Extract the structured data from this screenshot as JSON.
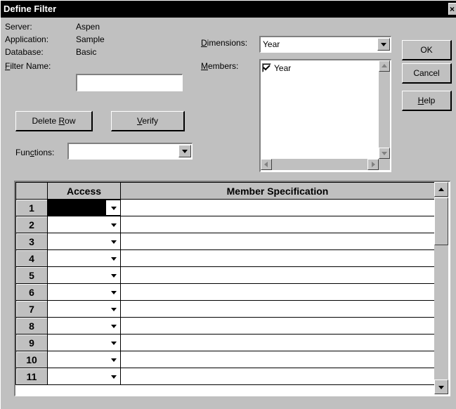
{
  "window": {
    "title": "Define Filter",
    "close_glyph": "×"
  },
  "info": {
    "server_label": "Server:",
    "server_value": "Aspen",
    "application_label": "Application:",
    "application_value": "Sample",
    "database_label": "Database:",
    "database_value": "Basic",
    "filter_name_label_ul": "F",
    "filter_name_label_rest": "ilter Name:",
    "filter_name_value": ""
  },
  "buttons": {
    "delete_row_pre": "Delete ",
    "delete_row_ul": "R",
    "delete_row_post": "ow",
    "verify_ul": "V",
    "verify_rest": "erify",
    "ok": "OK",
    "cancel": "Cancel",
    "help_ul": "H",
    "help_rest": "elp"
  },
  "functions": {
    "label_pre": "Fun",
    "label_ul": "c",
    "label_post": "tions:",
    "value": ""
  },
  "dimensions": {
    "label_ul": "D",
    "label_rest": "imensions:",
    "value": "Year"
  },
  "members": {
    "label_ul": "M",
    "label_rest": "embers:",
    "items": [
      {
        "label": "Year",
        "checked": true
      }
    ]
  },
  "grid": {
    "columns": [
      "Access",
      "Member Specification"
    ],
    "rows": [
      {
        "num": "1",
        "access": "",
        "spec": ""
      },
      {
        "num": "2",
        "access": "",
        "spec": ""
      },
      {
        "num": "3",
        "access": "",
        "spec": ""
      },
      {
        "num": "4",
        "access": "",
        "spec": ""
      },
      {
        "num": "5",
        "access": "",
        "spec": ""
      },
      {
        "num": "6",
        "access": "",
        "spec": ""
      },
      {
        "num": "7",
        "access": "",
        "spec": ""
      },
      {
        "num": "8",
        "access": "",
        "spec": ""
      },
      {
        "num": "9",
        "access": "",
        "spec": ""
      },
      {
        "num": "10",
        "access": "",
        "spec": ""
      },
      {
        "num": "11",
        "access": "",
        "spec": ""
      }
    ],
    "selected_row": 0
  },
  "icons": {
    "dropdown": "chevron-down-icon",
    "scroll_up": "scroll-up-arrow-icon",
    "scroll_down": "scroll-down-arrow-icon",
    "scroll_left": "scroll-left-arrow-icon",
    "scroll_right": "scroll-right-arrow-icon",
    "check": "checkmark-icon"
  },
  "colors": {
    "face": "#c0c0c0",
    "titlebar": "#000000",
    "selected_cell": "#000000"
  }
}
